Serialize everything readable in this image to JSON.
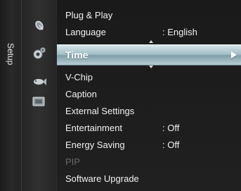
{
  "tab": {
    "label": "Setup"
  },
  "icons": [
    "satellite-dish-icon",
    "gear-icon",
    "fish-icon",
    "input-icon"
  ],
  "menu": {
    "items": [
      {
        "label": "Plug & Play",
        "value": ""
      },
      {
        "label": "Language",
        "value": ": English"
      },
      {
        "label": "Time",
        "value": ""
      },
      {
        "label": "V-Chip",
        "value": ""
      },
      {
        "label": "Caption",
        "value": ""
      },
      {
        "label": "External Settings",
        "value": ""
      },
      {
        "label": "Entertainment",
        "value": ": Off"
      },
      {
        "label": "Energy Saving",
        "value": ": Off"
      },
      {
        "label": "PIP",
        "value": ""
      },
      {
        "label": "Software Upgrade",
        "value": ""
      }
    ]
  },
  "colors": {
    "highlight": "#9fbcc4",
    "disabled": "#6b6b6b"
  }
}
